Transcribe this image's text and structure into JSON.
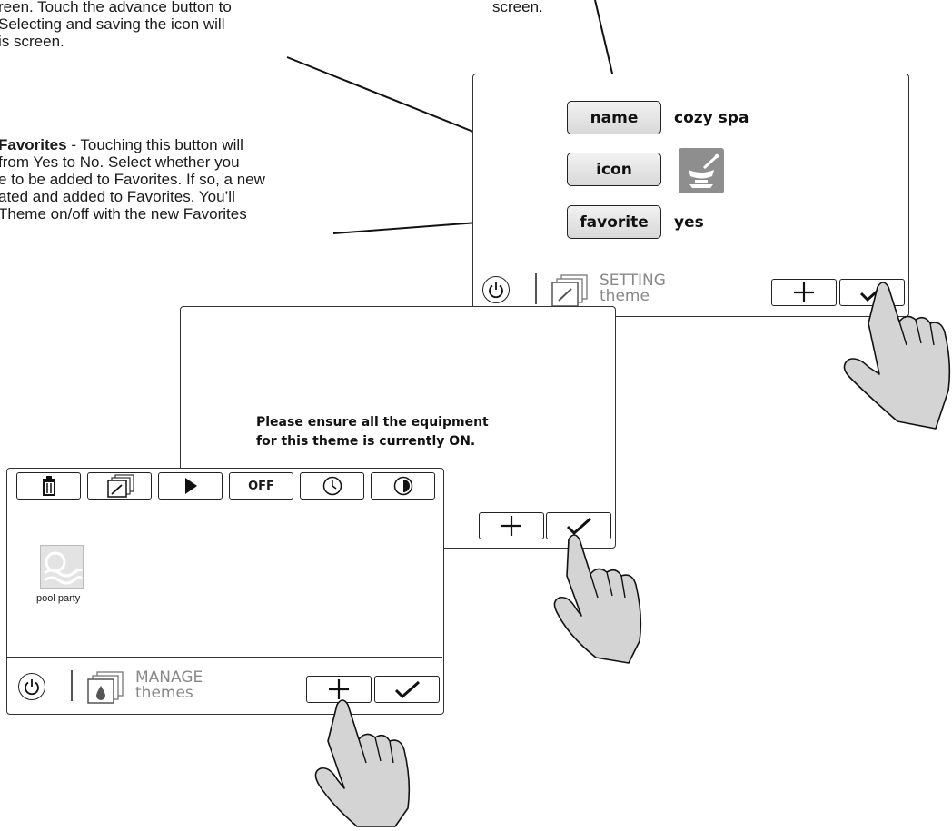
{
  "callouts": {
    "icon_text": [
      "reen.  Touch the advance button to",
      "Selecting and saving the icon will",
      "is screen."
    ],
    "name_text": [
      "screen."
    ],
    "favorites_bold": "Favorites",
    "favorites_rest": " - Touching this button will",
    "favorites_text": [
      "from Yes to No. Select whether you",
      "e to be added to Favorites. If so, a new",
      "ated and added to Favorites.  You’ll",
      "Theme on/off with the new Favorites"
    ]
  },
  "setting_screen": {
    "name_button": "name",
    "name_value": "cozy spa",
    "icon_button": "icon",
    "icon_value_icon": "cozy-spa-icon",
    "favorite_button": "favorite",
    "favorite_value": "yes",
    "bar_title": "SETTING",
    "bar_subtitle": "theme"
  },
  "confirm_screen": {
    "message_line1": "Please ensure all the equipment",
    "message_line2": "for this theme is currently ON."
  },
  "manage_screen": {
    "toolbar": {
      "delete_icon": "trash-icon",
      "edit_icon": "edit-theme-icon",
      "play_icon": "play-icon",
      "off_label": "OFF",
      "timer_icon": "clock-icon",
      "light_icon": "light-show-icon"
    },
    "theme_tile_label": "pool party",
    "bar_title": "MANAGE",
    "bar_subtitle": "themes"
  },
  "colors": {
    "outline": "#222222",
    "muted_text": "#888888",
    "hand_fill": "#d4d4d4"
  }
}
